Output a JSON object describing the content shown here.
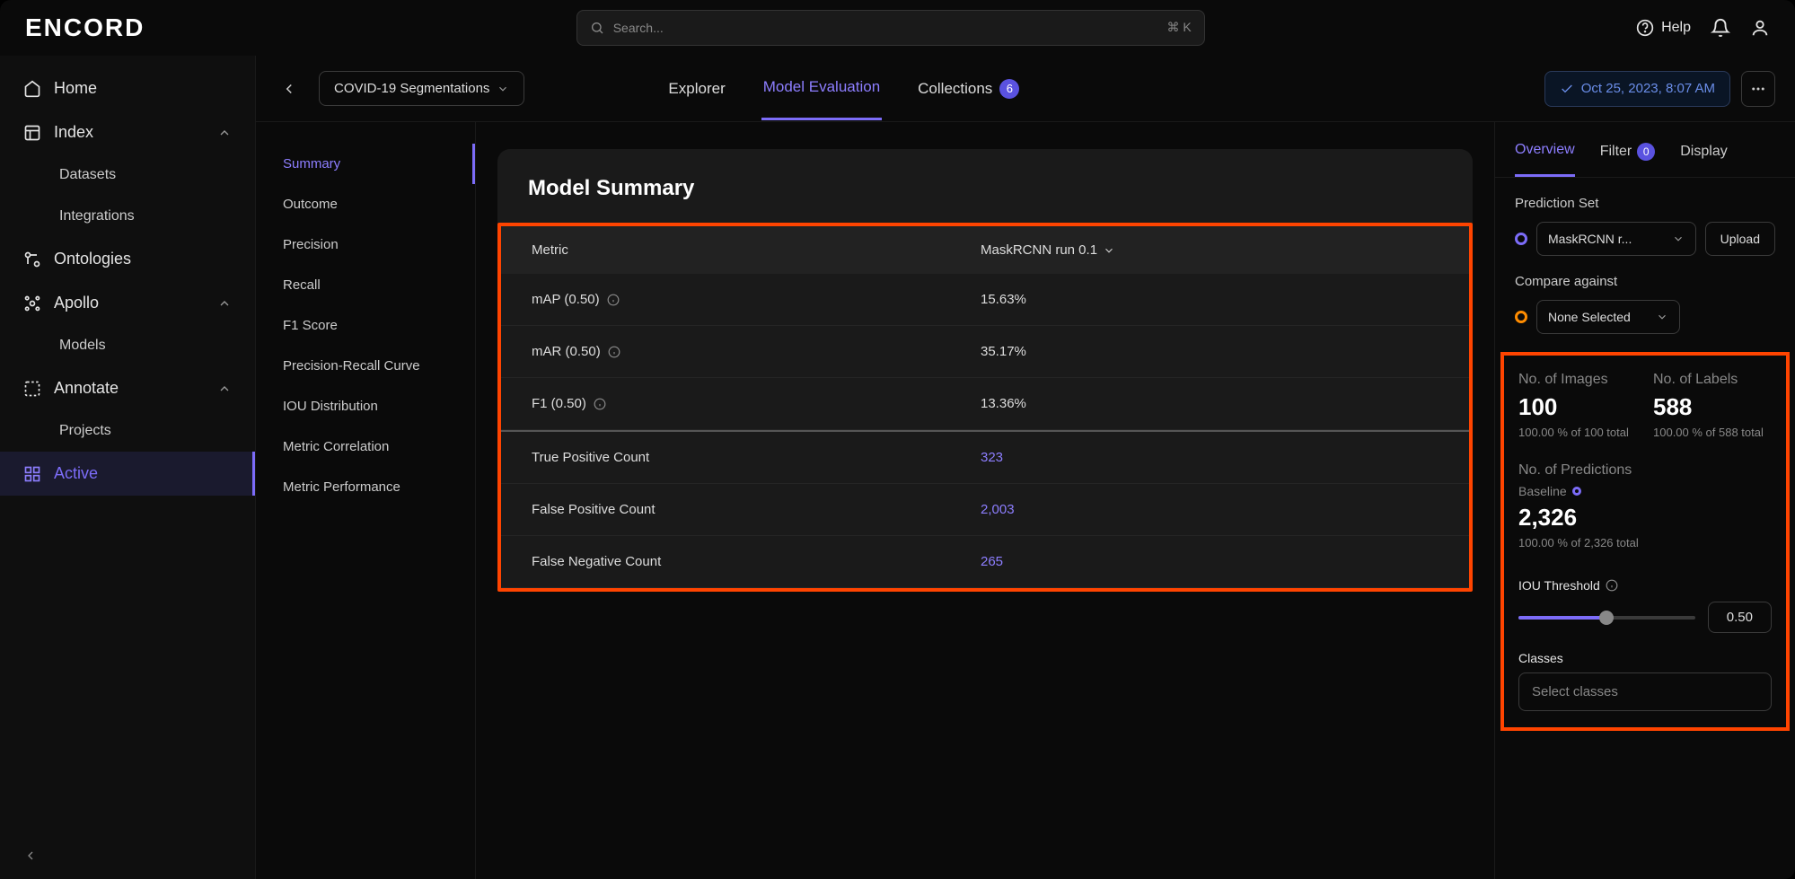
{
  "brand": "ENCORD",
  "search": {
    "placeholder": "Search...",
    "kbd": "⌘ K"
  },
  "top": {
    "help": "Help"
  },
  "sidebar": {
    "home": "Home",
    "index": "Index",
    "datasets": "Datasets",
    "integrations": "Integrations",
    "ontologies": "Ontologies",
    "apollo": "Apollo",
    "models": "Models",
    "annotate": "Annotate",
    "projects": "Projects",
    "active": "Active"
  },
  "header": {
    "project": "COVID-19 Segmentations",
    "tab_explorer": "Explorer",
    "tab_model_eval": "Model Evaluation",
    "tab_collections": "Collections",
    "collections_count": "6",
    "timestamp": "Oct 25, 2023, 8:07 AM"
  },
  "sublist": [
    "Summary",
    "Outcome",
    "Precision",
    "Recall",
    "F1 Score",
    "Precision-Recall Curve",
    "IOU Distribution",
    "Metric Correlation",
    "Metric Performance"
  ],
  "card": {
    "title": "Model Summary",
    "col_metric": "Metric",
    "col_model": "MaskRCNN run 0.1",
    "rows": [
      {
        "metric": "mAP (0.50)",
        "info": true,
        "value": "15.63%",
        "link": false
      },
      {
        "metric": "mAR (0.50)",
        "info": true,
        "value": "35.17%",
        "link": false
      },
      {
        "metric": "F1 (0.50)",
        "info": true,
        "value": "13.36%",
        "link": false
      },
      {
        "metric": "True Positive Count",
        "info": false,
        "value": "323",
        "link": true,
        "sep": true
      },
      {
        "metric": "False Positive Count",
        "info": false,
        "value": "2,003",
        "link": true
      },
      {
        "metric": "False Negative Count",
        "info": false,
        "value": "265",
        "link": true
      }
    ]
  },
  "rpanel": {
    "tab_overview": "Overview",
    "tab_filter": "Filter",
    "filter_count": "0",
    "tab_display": "Display",
    "pred_set_label": "Prediction Set",
    "pred_set_value": "MaskRCNN r...",
    "upload": "Upload",
    "compare_label": "Compare against",
    "compare_value": "None Selected",
    "stats": {
      "images_label": "No. of Images",
      "images_val": "100",
      "images_sub": "100.00 % of 100 total",
      "labels_label": "No. of Labels",
      "labels_val": "588",
      "labels_sub": "100.00 % of 588 total",
      "preds_label": "No. of Predictions",
      "baseline": "Baseline",
      "preds_val": "2,326",
      "preds_sub": "100.00 % of 2,326 total"
    },
    "iou_label": "IOU Threshold",
    "iou_value": "0.50",
    "classes_label": "Classes",
    "classes_placeholder": "Select classes"
  }
}
